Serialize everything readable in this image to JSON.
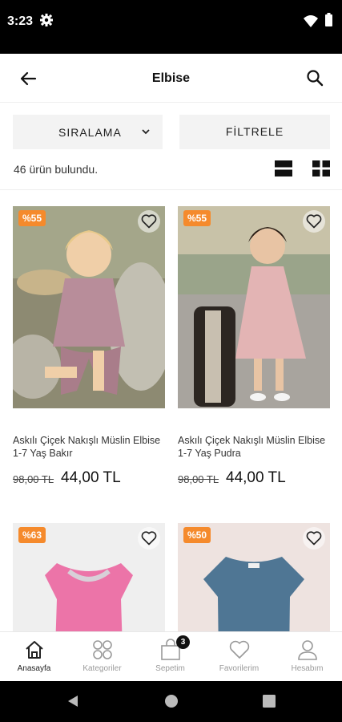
{
  "status_bar": {
    "time": "3:23"
  },
  "header": {
    "title": "Elbise"
  },
  "toolbar": {
    "sort_label": "SIRALAMA",
    "filter_label": "FİLTRELE"
  },
  "results": {
    "count_text": "46 ürün bulundu."
  },
  "products": [
    {
      "discount": "%55",
      "name": "Askılı Çiçek Nakışlı Müslin Elbise 1-7 Yaş Bakır",
      "old_price": "98,00 TL",
      "price": "44,00 TL"
    },
    {
      "discount": "%55",
      "name": "Askılı Çiçek Nakışlı Müslin Elbise 1-7 Yaş Pudra",
      "old_price": "98,00 TL",
      "price": "44,00 TL"
    },
    {
      "discount": "%63",
      "name": "",
      "old_price": "",
      "price": ""
    },
    {
      "discount": "%50",
      "name": "",
      "old_price": "",
      "price": ""
    }
  ],
  "bottom_nav": {
    "items": [
      {
        "label": "Anasayfa",
        "icon": "home-icon"
      },
      {
        "label": "Kategoriler",
        "icon": "categories-icon"
      },
      {
        "label": "Sepetim",
        "icon": "cart-icon",
        "badge": "3"
      },
      {
        "label": "Favorilerim",
        "icon": "heart-icon"
      },
      {
        "label": "Hesabım",
        "icon": "user-icon"
      }
    ]
  },
  "colors": {
    "discount_badge": "#f58a2c",
    "accent": "#111111"
  }
}
